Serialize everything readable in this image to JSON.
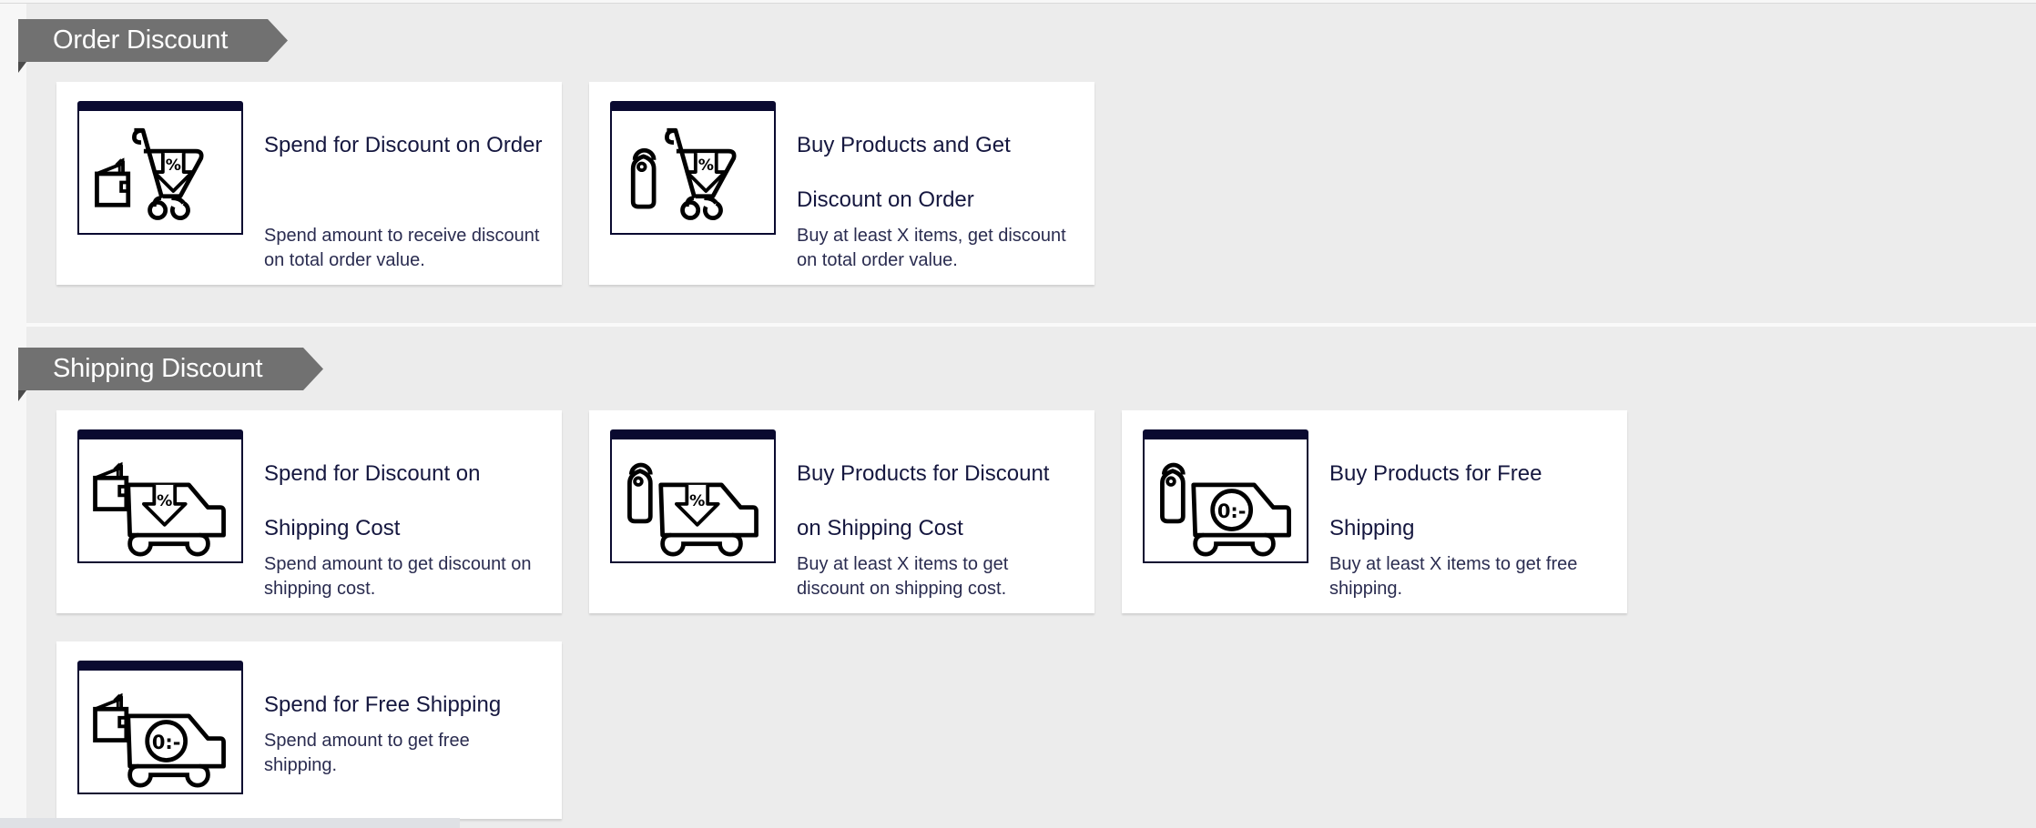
{
  "sections": [
    {
      "title": "Order Discount",
      "cards": [
        {
          "title": "Spend for Discount on Order",
          "description": "Spend amount to receive discount on total order value.",
          "icon": "wallet-cart-percent-icon"
        },
        {
          "title": "Buy Products and Get Discount on Order",
          "description": "Buy at least X items, get discount on total order value.",
          "icon": "tag-cart-percent-icon"
        }
      ]
    },
    {
      "title": "Shipping Discount",
      "cards": [
        {
          "title": "Spend for Discount on Shipping Cost",
          "description": "Spend amount to get discount on shipping cost.",
          "icon": "wallet-truck-percent-icon"
        },
        {
          "title": "Buy Products for Discount on Shipping Cost",
          "description": "Buy at least X items to get discount on shipping cost.",
          "icon": "tag-truck-percent-icon"
        },
        {
          "title": "Buy Products for Free Shipping",
          "description": "Buy at least X items to get free shipping.",
          "icon": "tag-truck-free-icon"
        },
        {
          "title": "Spend for Free Shipping",
          "description": "Spend amount to get free shipping.",
          "icon": "wallet-truck-free-icon"
        }
      ]
    }
  ],
  "colors": {
    "ribbon": "#717171",
    "icon_frame": "#0a0a30",
    "title_text": "#15173f",
    "background": "#ececec"
  },
  "icon_text": {
    "percent": "%",
    "free": "0:-"
  }
}
